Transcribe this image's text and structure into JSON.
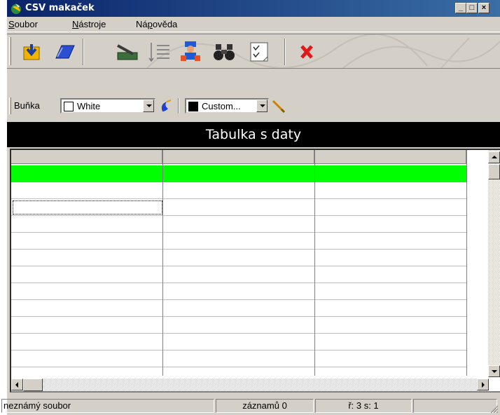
{
  "window": {
    "title": "CSV makaček",
    "minimize_glyph": "_",
    "maximize_glyph": "□",
    "close_glyph": "×"
  },
  "menu": [
    {
      "label": "Soubor",
      "accel": "S",
      "rest": "oubor"
    },
    {
      "label": "Nástroje",
      "accel": "N",
      "rest": "ástroje"
    },
    {
      "label": "Nápověda",
      "pre": "Ná",
      "accel": "p",
      "rest": "ověda"
    }
  ],
  "toolbar": {
    "buttons": [
      {
        "icon": "open-folder-icon"
      },
      {
        "icon": "save-book-icon"
      },
      {
        "icon": "edit-pencil-icon"
      },
      {
        "icon": "list-icon"
      },
      {
        "icon": "worker-icon"
      },
      {
        "icon": "binoculars-icon"
      },
      {
        "icon": "checklist-icon"
      },
      {
        "icon": "delete-x-icon"
      }
    ]
  },
  "format_bar": {
    "cell_label": "Buňka",
    "cell_color_value": "White",
    "cell_color_swatch": "#ffffff",
    "text_color_value": "Custom...",
    "text_color_swatch": "#000000"
  },
  "table": {
    "title": "Tabulka s daty",
    "highlight_color": "#00ff00"
  },
  "status": {
    "file": "neznámý soubor",
    "records": "záznamů 0",
    "position": "ř: 3 s: 1",
    "extra": ""
  }
}
